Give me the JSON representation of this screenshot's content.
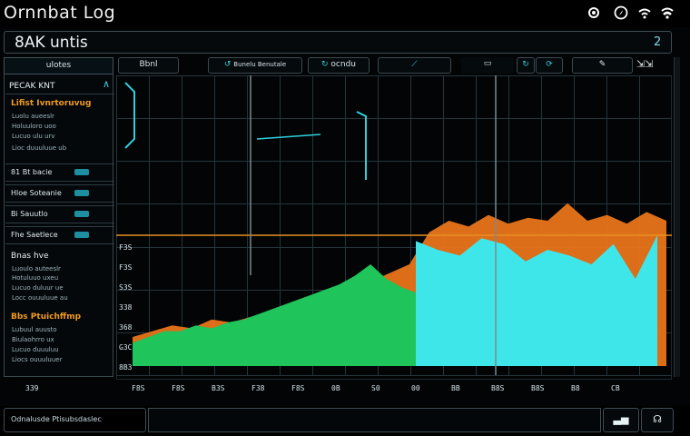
{
  "window": {
    "title": "Ornnbat Log",
    "icons": [
      "settings-icon",
      "compass-icon",
      "wifi-icon",
      "signal-icon"
    ]
  },
  "header": {
    "title": "8AK untis",
    "number": "2"
  },
  "sidebar": {
    "top_button": "ulotes",
    "panel_title": "PECAK KNT",
    "section1": {
      "title": "Lifist Ivnrtoruvug",
      "lines": [
        "Luolu aueeslr",
        "Holuuloro uoo",
        "Lucuo ulu urv",
        "Lioc duuuluue ub"
      ]
    },
    "rows": [
      {
        "label": "81 Bt bacie"
      },
      {
        "label": "Hloe Soteanie"
      },
      {
        "label": "Bi Sauutlo"
      },
      {
        "label": "Fhe Saetlece"
      }
    ],
    "section2": {
      "title": "Bnas hve",
      "lines": [
        "Luoulo auteeslr",
        "Hotuluuo uxeu",
        "Lucuo duluur ue",
        "Locc ouuuluue au"
      ]
    },
    "section3": {
      "title": "Bbs Ptuichffmp",
      "lines": [
        "Lubuul auusto",
        "Biulaohrro ux",
        "Lucuo duuuluu",
        "Liocs ouuuluuer"
      ]
    },
    "bottom_label": "339"
  },
  "toolbar": {
    "buttons": [
      "Bbnl",
      "Bunelu Benutale",
      "ocndu",
      "",
      "",
      "",
      "",
      ""
    ]
  },
  "chart_data": {
    "type": "area",
    "y_ticks": [
      "F3S",
      "F3S",
      "S3S",
      "338",
      "368",
      "G3C",
      "8B3"
    ],
    "x_ticks": [
      "F8S",
      "F8S",
      "B3S",
      "F38",
      "F8S",
      "0B",
      "S0",
      "00",
      "BB",
      "B8S",
      "B8S",
      "B8",
      "CB"
    ],
    "series": [
      {
        "color": "#1fc45a",
        "values": [
          8,
          10,
          12,
          12,
          14,
          13,
          15,
          16,
          18,
          20,
          22,
          24,
          26,
          28,
          31,
          35,
          30,
          27,
          25,
          22
        ]
      },
      {
        "color": "#e8741a",
        "values": [
          10,
          12,
          14,
          13,
          16,
          15,
          17,
          18,
          20,
          22,
          24,
          27,
          29,
          32,
          35,
          46,
          50,
          48,
          52,
          49,
          51,
          50,
          56,
          50,
          52,
          49,
          53,
          50
        ]
      },
      {
        "color": "#3ee6ea",
        "values": [
          0,
          0,
          0,
          0,
          0,
          0,
          0,
          0,
          0,
          0,
          0,
          0,
          0,
          0,
          0,
          0,
          43,
          40,
          38,
          44,
          42,
          36,
          40,
          38,
          35,
          42,
          30,
          45
        ]
      }
    ],
    "ylim": [
      0,
      100
    ],
    "grid": true
  },
  "footer": {
    "status": "Odnalusde Ptisubsdaslec",
    "cmd_value": "",
    "btn1": "",
    "btn2": ""
  },
  "colors": {
    "grid": "#26353c",
    "accent": "#2fd0dc",
    "orange": "#f29a1f",
    "baseline": "#e89020"
  }
}
